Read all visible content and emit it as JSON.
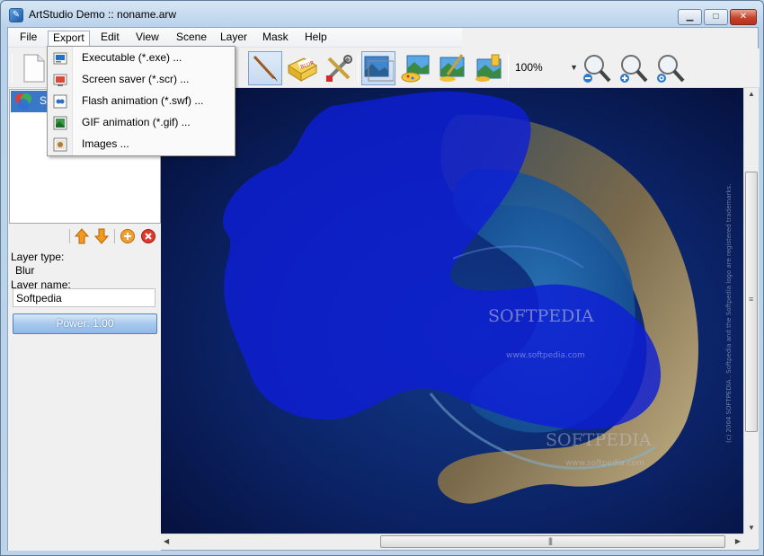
{
  "window": {
    "title": "ArtStudio Demo :: noname.arw",
    "min_glyph": "▁",
    "max_glyph": "□",
    "close_glyph": "✕",
    "app_icon_glyph": "✎"
  },
  "menu": {
    "items": [
      {
        "label": "File"
      },
      {
        "label": "Export"
      },
      {
        "label": "Edit"
      },
      {
        "label": "View"
      },
      {
        "label": "Scene"
      },
      {
        "label": "Layer"
      },
      {
        "label": "Mask"
      },
      {
        "label": "Help"
      }
    ],
    "open_index": 1
  },
  "export_menu": {
    "items": [
      {
        "label": "Executable (*.exe) ...",
        "icon": "exe-icon"
      },
      {
        "label": "Screen saver (*.scr) ...",
        "icon": "screensaver-icon"
      },
      {
        "label": "Flash animation (*.swf) ...",
        "icon": "flash-icon"
      },
      {
        "label": "GIF animation (*.gif) ...",
        "icon": "gif-icon"
      },
      {
        "label": "Images ...",
        "icon": "images-icon"
      }
    ]
  },
  "toolbar": {
    "zoom_value": "100%",
    "zoom_arrow": "▼",
    "tools": [
      "new-document-icon",
      "brush-icon",
      "blur-icon",
      "tools-icon",
      "picture-icon",
      "paint-picture-icon",
      "brush-picture-icon",
      "spray-picture-icon",
      "zoom-out-icon",
      "zoom-in-icon",
      "zoom-reset-icon"
    ]
  },
  "layers": {
    "selected_layer_label": "S",
    "layer_type_label": "Layer type:",
    "layer_type_value": "Blur",
    "layer_name_label": "Layer name:",
    "layer_name_value": "Softpedia",
    "power_label": "Power: 1.00"
  },
  "canvas": {
    "watermark_main": "SOFTPEDIA",
    "watermark_url": "www.softpedia.com",
    "watermark_main_2": "SOFTPEDIA",
    "watermark_url_2": "www.softpedia.com",
    "side_text": "(c) 2004 SOFTPEDIA . Softpedia and the Softpedia logo are registered trademarks."
  },
  "colors": {
    "menu_highlight_border": "#9ab0c8",
    "selection_blue": "#3a77c6",
    "overlay_blue": "#0e1ed6",
    "close_red": "#c5422c"
  }
}
